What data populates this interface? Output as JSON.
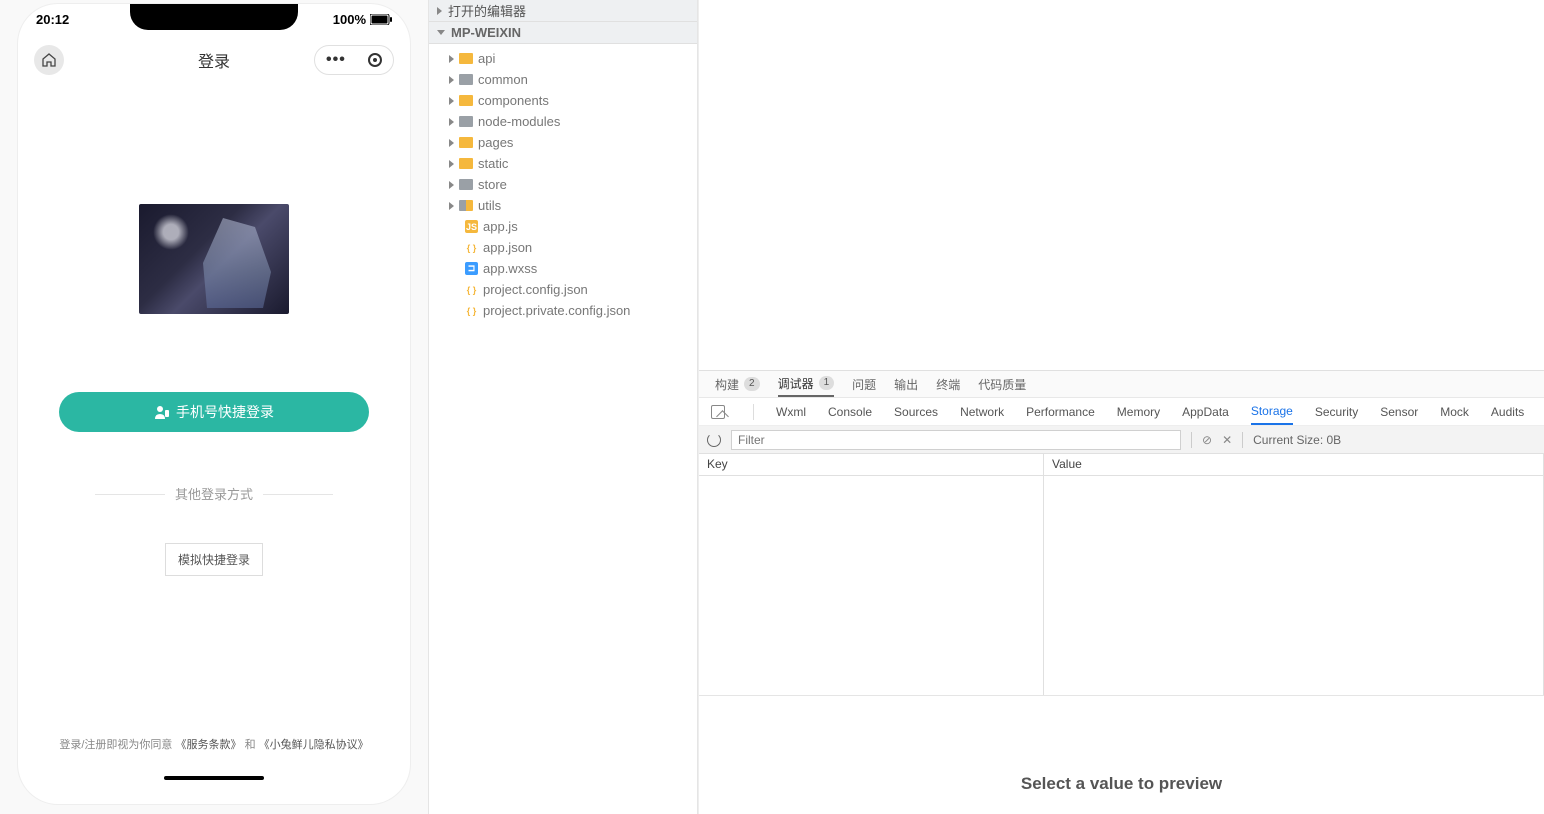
{
  "simulator": {
    "time": "20:12",
    "battery_pct": "100%",
    "nav_title": "登录",
    "login_button": "手机号快捷登录",
    "other_login": "其他登录方式",
    "mock_login": "模拟快捷登录",
    "agree_prefix": "登录/注册即视为你同意",
    "agree_link1": "《服务条款》",
    "agree_mid": "和",
    "agree_link2": "《小兔鲜儿隐私协议》"
  },
  "explorer": {
    "section_editors": "打开的编辑器",
    "project_name": "MP-WEIXIN",
    "folders": [
      {
        "name": "api",
        "color": "orange"
      },
      {
        "name": "common",
        "color": "grey"
      },
      {
        "name": "components",
        "color": "orange"
      },
      {
        "name": "node-modules",
        "color": "grey"
      },
      {
        "name": "pages",
        "color": "orange"
      },
      {
        "name": "static",
        "color": "orange"
      },
      {
        "name": "store",
        "color": "grey"
      },
      {
        "name": "utils",
        "color": "greymix"
      }
    ],
    "files": [
      {
        "name": "app.js",
        "type": "js"
      },
      {
        "name": "app.json",
        "type": "json"
      },
      {
        "name": "app.wxss",
        "type": "wxss"
      },
      {
        "name": "project.config.json",
        "type": "json"
      },
      {
        "name": "project.private.config.json",
        "type": "json"
      }
    ]
  },
  "panel_tabs": {
    "build": "构建",
    "build_badge": "2",
    "debugger": "调试器",
    "debugger_badge": "1",
    "problems": "问题",
    "output": "输出",
    "terminal": "终端",
    "quality": "代码质量"
  },
  "devtools": [
    "Wxml",
    "Console",
    "Sources",
    "Network",
    "Performance",
    "Memory",
    "AppData",
    "Storage",
    "Security",
    "Sensor",
    "Mock",
    "Audits"
  ],
  "devtools_active": "Storage",
  "storage_toolbar": {
    "filter_placeholder": "Filter",
    "size_label": "Current Size: 0B"
  },
  "storage_headers": {
    "key": "Key",
    "value": "Value"
  },
  "preview_text": "Select a value to preview"
}
